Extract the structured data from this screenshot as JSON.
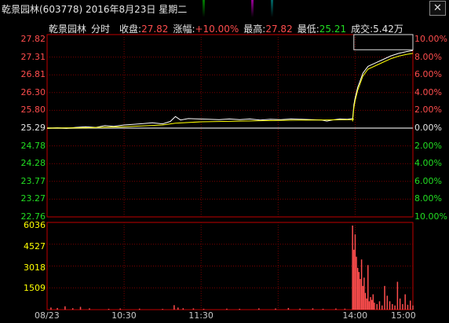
{
  "window": {
    "title": "乾景园林(603778) 2016年8月23日 星期二",
    "close_label": "✕"
  },
  "info_bar": {
    "name": "乾景园林",
    "mode": "分时",
    "close_label": "收盘:",
    "close_value": "27.82",
    "change_label": "涨幅:",
    "change_value": "+10.00%",
    "high_label": "最高:",
    "high_value": "27.82",
    "low_label": "最低:",
    "low_value": "25.21",
    "volume_label": "成交:",
    "volume_value": "5.42万"
  },
  "colors": {
    "up": "#ff4d4d",
    "down": "#22dd22",
    "price_line": "#ffffff",
    "avg_line": "#ffff00",
    "grid": "#7a0000",
    "axis": "#c00000"
  },
  "chart_data": {
    "type": "line",
    "price_axis_labels": [
      "27.82",
      "27.31",
      "26.81",
      "26.30",
      "25.80",
      "25.29",
      "24.78",
      "24.28",
      "23.77",
      "23.27",
      "22.76"
    ],
    "percent_axis_labels": [
      "10.00%",
      "8.00%",
      "6.00%",
      "4.00%",
      "2.00%",
      "0.00%",
      "2.00%",
      "4.00%",
      "6.00%",
      "8.00%",
      "10.00%"
    ],
    "volume_axis_labels": [
      "6036",
      "4527",
      "3018",
      "1509"
    ],
    "x_labels": [
      "08/23",
      "10:30",
      "11:30",
      "14:00",
      "15:00"
    ],
    "ylim": [
      22.76,
      27.82
    ],
    "prev_close": 25.29,
    "volume_ylim": [
      0,
      6036
    ],
    "price": [
      [
        0,
        25.28
      ],
      [
        8,
        25.3
      ],
      [
        15,
        25.28
      ],
      [
        22,
        25.31
      ],
      [
        30,
        25.33
      ],
      [
        38,
        25.31
      ],
      [
        45,
        25.36
      ],
      [
        52,
        25.34
      ],
      [
        60,
        25.38
      ],
      [
        68,
        25.4
      ],
      [
        75,
        25.42
      ],
      [
        82,
        25.44
      ],
      [
        90,
        25.41
      ],
      [
        96,
        25.48
      ],
      [
        100,
        25.62
      ],
      [
        104,
        25.52
      ],
      [
        110,
        25.56
      ],
      [
        118,
        25.55
      ],
      [
        126,
        25.54
      ],
      [
        134,
        25.53
      ],
      [
        142,
        25.55
      ],
      [
        150,
        25.53
      ],
      [
        158,
        25.55
      ],
      [
        166,
        25.52
      ],
      [
        174,
        25.54
      ],
      [
        182,
        25.53
      ],
      [
        190,
        25.55
      ],
      [
        198,
        25.54
      ],
      [
        206,
        25.53
      ],
      [
        214,
        25.52
      ],
      [
        218,
        25.49
      ],
      [
        222,
        25.52
      ],
      [
        228,
        25.55
      ],
      [
        234,
        25.54
      ],
      [
        238,
        25.56
      ],
      [
        239,
        25.95
      ],
      [
        240,
        26.15
      ],
      [
        242,
        26.45
      ],
      [
        244,
        26.65
      ],
      [
        246,
        26.85
      ],
      [
        250,
        27.05
      ],
      [
        256,
        27.15
      ],
      [
        262,
        27.25
      ],
      [
        268,
        27.35
      ],
      [
        274,
        27.42
      ],
      [
        280,
        27.47
      ],
      [
        285,
        27.5
      ]
    ],
    "average": [
      [
        0,
        25.29
      ],
      [
        30,
        25.3
      ],
      [
        60,
        25.33
      ],
      [
        90,
        25.38
      ],
      [
        100,
        25.43
      ],
      [
        120,
        25.47
      ],
      [
        150,
        25.49
      ],
      [
        180,
        25.51
      ],
      [
        210,
        25.52
      ],
      [
        238,
        25.53
      ],
      [
        239,
        25.55
      ]
    ],
    "volume": [
      {
        "t": 3,
        "v": 150
      },
      {
        "t": 8,
        "v": 120
      },
      {
        "t": 14,
        "v": 240
      },
      {
        "t": 20,
        "v": 100
      },
      {
        "t": 26,
        "v": 200
      },
      {
        "t": 33,
        "v": 90
      },
      {
        "t": 48,
        "v": 60
      },
      {
        "t": 57,
        "v": 80
      },
      {
        "t": 72,
        "v": 70
      },
      {
        "t": 90,
        "v": 50
      },
      {
        "t": 99,
        "v": 320
      },
      {
        "t": 102,
        "v": 150
      },
      {
        "t": 106,
        "v": 100
      },
      {
        "t": 114,
        "v": 90
      },
      {
        "t": 122,
        "v": 60
      },
      {
        "t": 140,
        "v": 70
      },
      {
        "t": 150,
        "v": 60
      },
      {
        "t": 165,
        "v": 90
      },
      {
        "t": 178,
        "v": 80
      },
      {
        "t": 188,
        "v": 120
      },
      {
        "t": 197,
        "v": 70
      },
      {
        "t": 207,
        "v": 90
      },
      {
        "t": 215,
        "v": 60
      },
      {
        "t": 225,
        "v": 80
      },
      {
        "t": 232,
        "v": 70
      },
      {
        "t": 238,
        "v": 6036
      },
      {
        "t": 239,
        "v": 4300
      },
      {
        "t": 240,
        "v": 5400
      },
      {
        "t": 241,
        "v": 3800
      },
      {
        "t": 242,
        "v": 3000
      },
      {
        "t": 243,
        "v": 2700
      },
      {
        "t": 244,
        "v": 2200
      },
      {
        "t": 245,
        "v": 3600
      },
      {
        "t": 246,
        "v": 1700
      },
      {
        "t": 247,
        "v": 2300
      },
      {
        "t": 248,
        "v": 1200
      },
      {
        "t": 249,
        "v": 800
      },
      {
        "t": 250,
        "v": 3200
      },
      {
        "t": 251,
        "v": 600
      },
      {
        "t": 252,
        "v": 900
      },
      {
        "t": 253,
        "v": 700
      },
      {
        "t": 254,
        "v": 1100
      },
      {
        "t": 255,
        "v": 500
      },
      {
        "t": 257,
        "v": 400
      },
      {
        "t": 259,
        "v": 600
      },
      {
        "t": 261,
        "v": 300
      },
      {
        "t": 263,
        "v": 1700
      },
      {
        "t": 265,
        "v": 1000
      },
      {
        "t": 267,
        "v": 600
      },
      {
        "t": 269,
        "v": 400
      },
      {
        "t": 271,
        "v": 300
      },
      {
        "t": 273,
        "v": 2000
      },
      {
        "t": 275,
        "v": 800
      },
      {
        "t": 277,
        "v": 400
      },
      {
        "t": 279,
        "v": 1100
      },
      {
        "t": 281,
        "v": 350
      },
      {
        "t": 283,
        "v": 650
      },
      {
        "t": 285,
        "v": 300
      }
    ]
  }
}
